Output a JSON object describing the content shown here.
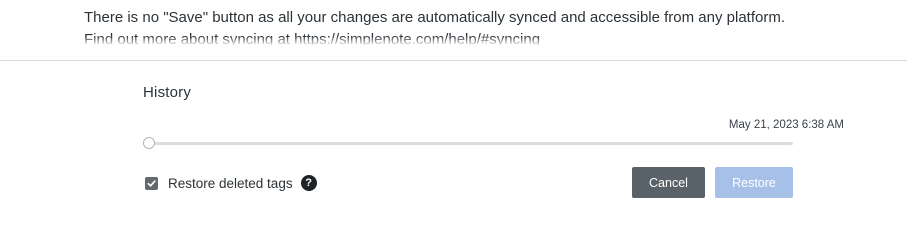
{
  "note": {
    "line1": "There is no \"Save\" button as all your changes are automatically synced and accessible from any platform.",
    "line2": "Find out more about syncing at https://simplenote.com/help/#syncing"
  },
  "history": {
    "title": "History",
    "date": "May 21, 2023 6:38 AM",
    "slider_position": 0,
    "restore_tags_label": "Restore deleted tags",
    "restore_tags_checked": true,
    "help_icon": "question-circle-icon",
    "help_glyph": "?",
    "cancel_label": "Cancel",
    "restore_label": "Restore",
    "restore_enabled": false
  },
  "colors": {
    "cancel_button": "#5a6269",
    "restore_button_disabled": "#a7c0e8",
    "checkbox": "#646970"
  }
}
